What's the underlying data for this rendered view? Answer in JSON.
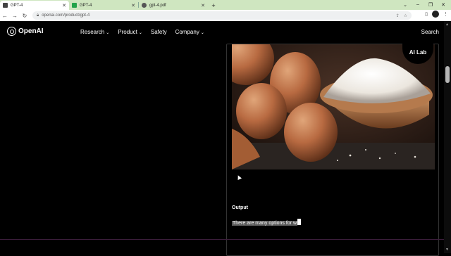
{
  "browser": {
    "tabs": [
      {
        "title": "GPT-4",
        "active": true,
        "favicon_color": "#444444"
      },
      {
        "title": "GPT-4",
        "active": false,
        "favicon_color": "#22a34a"
      },
      {
        "title": "gpt-4.pdf",
        "active": false,
        "favicon_color": "#555555"
      }
    ],
    "new_tab": "+",
    "url": "openai.com/product/gpt-4",
    "window_controls": {
      "dropdown": "⌄",
      "minimize": "–",
      "restore": "❐",
      "close": "✕"
    }
  },
  "site": {
    "logo": "OpenAI",
    "nav": [
      {
        "label": "Research",
        "dropdown": true
      },
      {
        "label": "Product",
        "dropdown": true
      },
      {
        "label": "Safety",
        "dropdown": false
      },
      {
        "label": "Company",
        "dropdown": true
      }
    ],
    "search_label": "Search",
    "badge": "AI Lab",
    "output_label": "Output",
    "output_text": "There are many options for w"
  },
  "colors": {
    "page_bg": "#000000",
    "tabbar_bg": "#cfe6c0",
    "badge_bg": "#000000"
  }
}
